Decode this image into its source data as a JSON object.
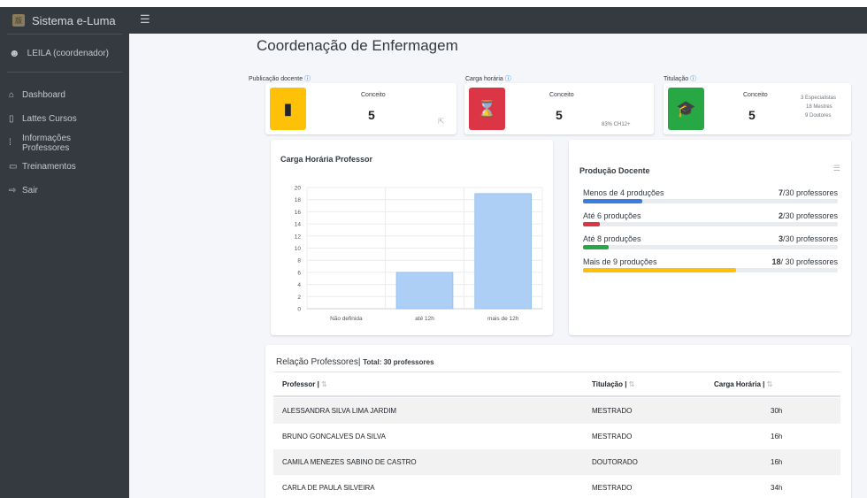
{
  "app": {
    "brand": "Sistema e-Luma",
    "brand_logo_text": "版"
  },
  "user": {
    "label": "LEILA (coordenador)"
  },
  "sidebar": {
    "items": [
      {
        "label": "Dashboard",
        "icon": "home-icon"
      },
      {
        "label": "Lattes Cursos",
        "icon": "file-icon"
      },
      {
        "label": "Informações Professores",
        "icon": "grid-icon"
      },
      {
        "label": "Treinamentos",
        "icon": "book-icon"
      },
      {
        "label": "Sair",
        "icon": "logout-icon"
      }
    ]
  },
  "page": {
    "title": "Coordenação de Enfermagem"
  },
  "stats": [
    {
      "label": "Publicação docente",
      "caption": "Conceito",
      "value": "5",
      "color": "#ffc107",
      "icon": "book-icon",
      "sub": ""
    },
    {
      "label": "Carga horária",
      "caption": "Conceito",
      "value": "5",
      "color": "#dc3545",
      "icon": "hourglass-icon",
      "sub": "83% CH12+"
    },
    {
      "label": "Titulação",
      "caption": "Conceito",
      "value": "5",
      "color": "#28a745",
      "icon": "graduation-cap-icon",
      "sub_lines": [
        "3 Especialistas",
        "18 Mestres",
        "9 Doutores"
      ]
    }
  ],
  "chart_card": {
    "title": "Carga Horária Professor"
  },
  "chart_data": {
    "type": "bar",
    "categories": [
      "Não definida",
      "até 12h",
      "mais de 12h"
    ],
    "values": [
      0,
      6,
      19
    ],
    "ylim": [
      0,
      20
    ],
    "yticks": [
      0,
      2,
      4,
      6,
      8,
      10,
      12,
      14,
      16,
      18,
      20
    ],
    "bar_color": "#aecff5",
    "grid": true
  },
  "production": {
    "title": "Produção Docente",
    "rows": [
      {
        "label": "Menos de 4 produções",
        "count": "7",
        "total": "/30 professores",
        "fraction": 0.233,
        "color": "#3b7ddd"
      },
      {
        "label": "Até 6 produções",
        "count": "2",
        "total": "/30 professores",
        "fraction": 0.067,
        "color": "#dc3545"
      },
      {
        "label": "Até 8 produções",
        "count": "3",
        "total": "/30 professores",
        "fraction": 0.1,
        "color": "#28a745"
      },
      {
        "label": "Mais de 9 produções",
        "count": "18",
        "total": "/ 30 professores",
        "fraction": 0.6,
        "color": "#ffc107"
      }
    ]
  },
  "table": {
    "title": "Relação Professores|",
    "total": "Total: 30 professores",
    "columns": [
      "Professor |",
      "Titulação |",
      "Carga Horária |"
    ],
    "sort_glyph": "⇅",
    "rows": [
      {
        "name": "ALESSANDRA SILVA LIMA JARDIM",
        "titulacao": "MESTRADO",
        "carga": "30h"
      },
      {
        "name": "BRUNO GONCALVES DA SILVA",
        "titulacao": "MESTRADO",
        "carga": "16h"
      },
      {
        "name": "CAMILA MENEZES SABINO DE CASTRO",
        "titulacao": "DOUTORADO",
        "carga": "16h"
      },
      {
        "name": "CARLA DE PAULA SILVEIRA",
        "titulacao": "MESTRADO",
        "carga": "34h"
      }
    ]
  }
}
